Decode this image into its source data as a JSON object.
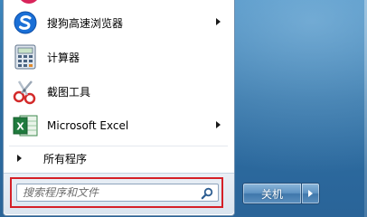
{
  "menu": {
    "items": [
      {
        "label": "搜狗高速浏览器",
        "icon": "sogou-browser-icon",
        "has_submenu": true
      },
      {
        "label": "计算器",
        "icon": "calculator-icon",
        "has_submenu": false
      },
      {
        "label": "截图工具",
        "icon": "snipping-tool-icon",
        "has_submenu": false
      },
      {
        "label": "Microsoft Excel",
        "icon": "excel-icon",
        "has_submenu": true
      }
    ],
    "all_programs_label": "所有程序"
  },
  "search": {
    "placeholder": "搜索程序和文件",
    "value": "",
    "icon": "search-icon"
  },
  "shutdown": {
    "label": "关机",
    "options_icon": "arrow-right-icon"
  },
  "colors": {
    "highlight_border": "#d52027",
    "glass": "#2d6ea3",
    "excel_green": "#1f7a3d"
  }
}
